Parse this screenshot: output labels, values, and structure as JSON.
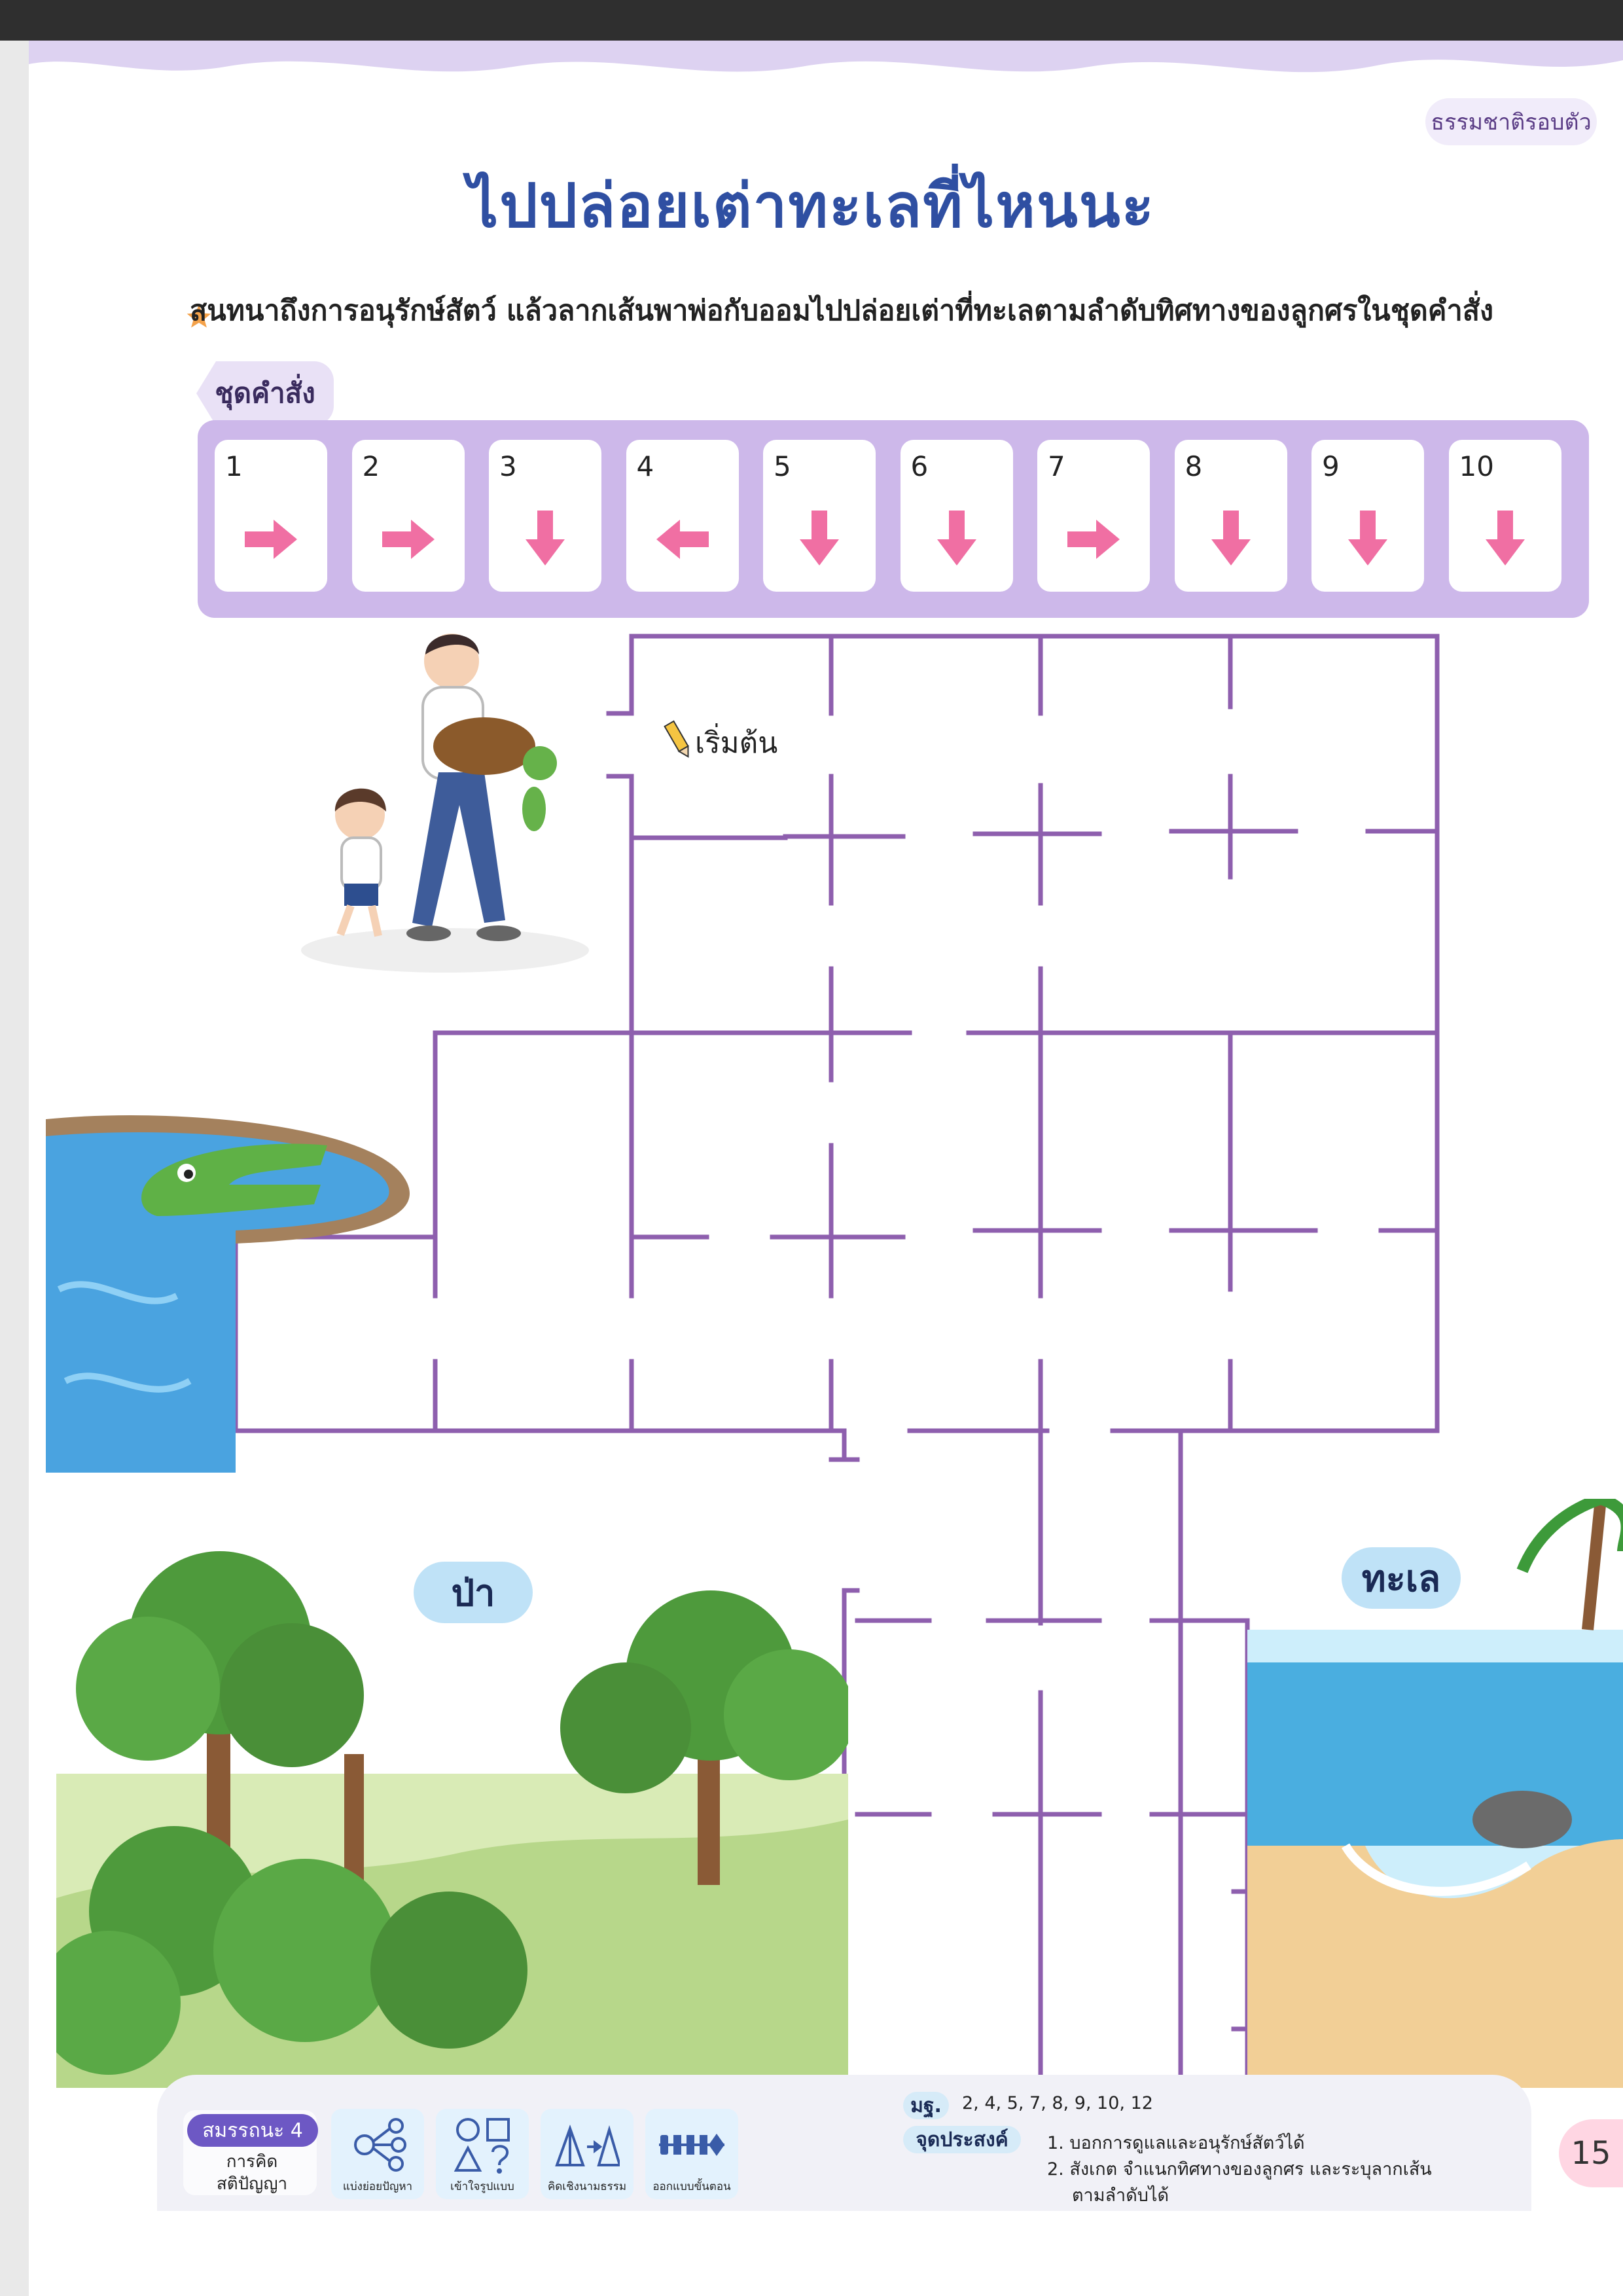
{
  "section_tag": "ธรรมชาติรอบตัว",
  "title": "ไปปล่อยเต่าทะเลที่ไหนนะ",
  "instruction": "สนทนาถึงการอนุรักษ์สัตว์ แล้วลากเส้นพาพ่อกับออมไปปล่อยเต่าที่ทะเลตามลำดับทิศทางของลูกศรในชุดคำสั่ง",
  "command_label": "ชุดคำสั่ง",
  "commands": [
    {
      "num": "1",
      "dir": "right"
    },
    {
      "num": "2",
      "dir": "right"
    },
    {
      "num": "3",
      "dir": "down"
    },
    {
      "num": "4",
      "dir": "left"
    },
    {
      "num": "5",
      "dir": "down"
    },
    {
      "num": "6",
      "dir": "down"
    },
    {
      "num": "7",
      "dir": "right"
    },
    {
      "num": "8",
      "dir": "down"
    },
    {
      "num": "9",
      "dir": "down"
    },
    {
      "num": "10",
      "dir": "down"
    }
  ],
  "start_label": "เริ่มต้น",
  "forest_label": "ป่า",
  "sea_label": "ทะเล",
  "competency": {
    "title": "สมรรถนะ 4",
    "subtitle_1": "การคิด",
    "subtitle_2": "สติปัญญา"
  },
  "skills": [
    "แบ่งย่อยปัญหา",
    "เข้าใจรูปแบบ",
    "คิดเชิงนามธรรม",
    "ออกแบบขั้นตอน"
  ],
  "standards_label": "มฐ.",
  "standards": "2, 4, 5, 7, 8, 9, 10, 12",
  "objectives_label": "จุดประสงค์",
  "objectives": [
    "1. บอกการดูแลและอนุรักษ์สัตว์ได้",
    "2. สังเกต จำแนกทิศทางของลูกศร และระบุลากเส้น",
    "ตามลำดับได้"
  ],
  "page_number": "15",
  "colors": {
    "title": "#2f4fa2",
    "maze_line": "#8e5fae",
    "arrow": "#f06fa3",
    "command_strip": "#cdb8ea"
  }
}
